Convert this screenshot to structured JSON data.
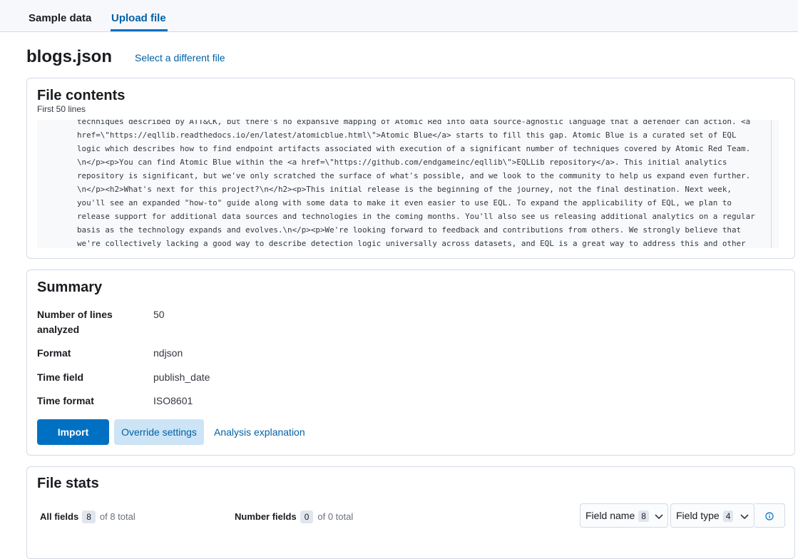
{
  "tabs": {
    "sample": "Sample data",
    "upload": "Upload file"
  },
  "file": {
    "name": "blogs.json",
    "select_different": "Select a different file"
  },
  "file_contents": {
    "title": "File contents",
    "subtitle": "First 50 lines",
    "text": "techniques described by ATT&CK, but there's no expansive mapping of Atomic Red into data source-agnostic language that a defender can action. <a\nhref=\\\"https://eqllib.readthedocs.io/en/latest/atomicblue.html\\\">Atomic Blue</a> starts to fill this gap. Atomic Blue is a curated set of EQL\nlogic which describes how to find endpoint artifacts associated with execution of a significant number of techniques covered by Atomic Red Team.\n\\n</p><p>You can find Atomic Blue within the <a href=\\\"https://github.com/endgameinc/eqllib\\\">EQLLib repository</a>. This initial analytics\nrepository is significant, but we've only scratched the surface of what's possible, and we look to the community to help us expand even further.\n\\n</p><h2>What's next for this project?\\n</h2><p>This initial release is the beginning of the journey, not the final destination. Next week,\nyou'll see an expanded \"how-to\" guide along with some data to make it even easier to use EQL. To expand the applicability of EQL, we plan to\nrelease support for additional data sources and technologies in the coming months. You'll also see us releasing additional analytics on a regular\nbasis as the technology expands and evolves.\\n</p><p>We're looking forward to feedback and contributions from others. We strongly believe that\nwe're collectively lacking a good way to describe detection logic universally across datasets, and EQL is a great way to address this and other"
  },
  "summary": {
    "title": "Summary",
    "rows": [
      {
        "label": "Number of lines analyzed",
        "value": "50"
      },
      {
        "label": "Format",
        "value": "ndjson"
      },
      {
        "label": "Time field",
        "value": "publish_date"
      },
      {
        "label": "Time format",
        "value": "ISO8601"
      }
    ],
    "buttons": {
      "import": "Import",
      "override": "Override settings",
      "analysis": "Analysis explanation"
    }
  },
  "file_stats": {
    "title": "File stats",
    "all_fields": {
      "label": "All fields",
      "count": "8",
      "total": "of 8 total"
    },
    "number_fields": {
      "label": "Number fields",
      "count": "0",
      "total": "of 0 total"
    },
    "filters": {
      "field_name": {
        "label": "Field name",
        "count": "8"
      },
      "field_type": {
        "label": "Field type",
        "count": "4"
      }
    }
  },
  "colors": {
    "primary": "#0071c2",
    "link": "#0061a6",
    "border": "#d3dae6",
    "override_bg": "#cce4f5"
  },
  "icons": {
    "chevron": "chevron-down-icon",
    "info": "info-icon"
  }
}
